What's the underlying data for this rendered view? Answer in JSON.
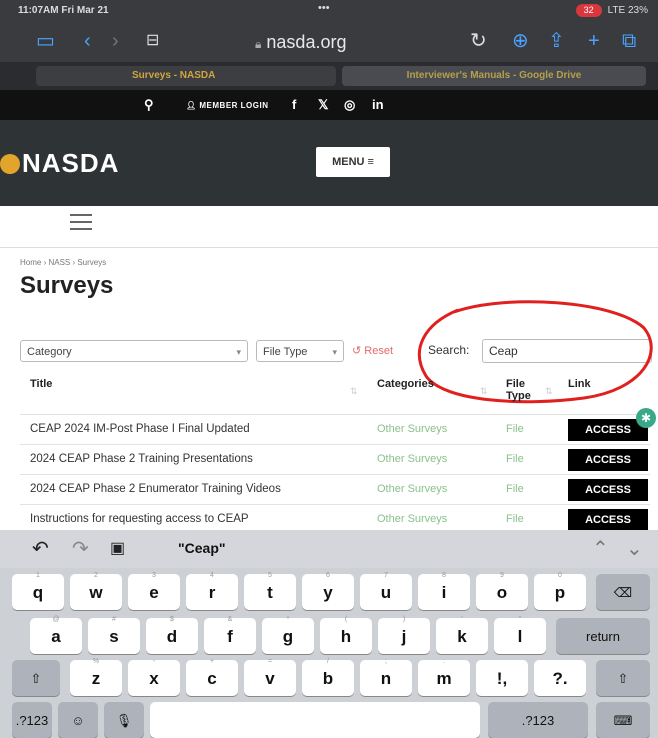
{
  "status": {
    "time": "11:07AM  Fri Mar 21",
    "dots": "•••",
    "signal": "LTE 23%",
    "rec": "32"
  },
  "browser": {
    "url": "nasda.org",
    "tab1": "Surveys - NASDA",
    "tab2": "Interviewer's Manuals - Google Drive"
  },
  "header": {
    "member_login": "MEMBER LOGIN",
    "logo": "NASDA",
    "menu": "MENU ≡"
  },
  "page": {
    "breadcrumb": "Home › NASS › Surveys",
    "title": "Surveys"
  },
  "filters": {
    "category": "Category",
    "file_type": "File Type",
    "reset": "Reset",
    "search_label": "Search:",
    "search_value": "Ceap"
  },
  "table": {
    "headers": {
      "title": "Title",
      "categories": "Categories",
      "file_type": "File Type",
      "link": "Link"
    },
    "rows": [
      {
        "title": "CEAP 2024 IM-Post Phase I Final Updated",
        "category": "Other Surveys",
        "type": "File",
        "link": "ACCESS"
      },
      {
        "title": "2024 CEAP Phase 2 Training Presentations",
        "category": "Other Surveys",
        "type": "File",
        "link": "ACCESS"
      },
      {
        "title": "2024 CEAP Phase 2 Enumerator Training Videos",
        "category": "Other Surveys",
        "type": "File",
        "link": "ACCESS"
      },
      {
        "title": "Instructions for requesting access to CEAP",
        "category": "Other Surveys",
        "type": "File",
        "link": "ACCESS"
      }
    ]
  },
  "keyboard": {
    "suggestion": "\"Ceap\"",
    "row1": [
      "q",
      "w",
      "e",
      "r",
      "t",
      "y",
      "u",
      "i",
      "o",
      "p"
    ],
    "row1_hints": [
      "1",
      "2",
      "3",
      "4",
      "5",
      "6",
      "7",
      "8",
      "9",
      "0"
    ],
    "row2": [
      "a",
      "s",
      "d",
      "f",
      "g",
      "h",
      "j",
      "k",
      "l"
    ],
    "row2_hints": [
      "@",
      "#",
      "$",
      "&",
      "*",
      "(",
      ")",
      "'",
      "\""
    ],
    "row3": [
      "z",
      "x",
      "c",
      "v",
      "b",
      "n",
      "m",
      "!\n,",
      "?\n."
    ],
    "row3_hints": [
      "%",
      "-",
      "+",
      "=",
      "/",
      ";",
      ":",
      "",
      ""
    ],
    "return": "return",
    "num_left": ".?123",
    "num_right": ".?123"
  },
  "colors": {
    "accent": "#e2a52c",
    "link_green": "#8bc08b",
    "annotation": "#e0201e"
  }
}
